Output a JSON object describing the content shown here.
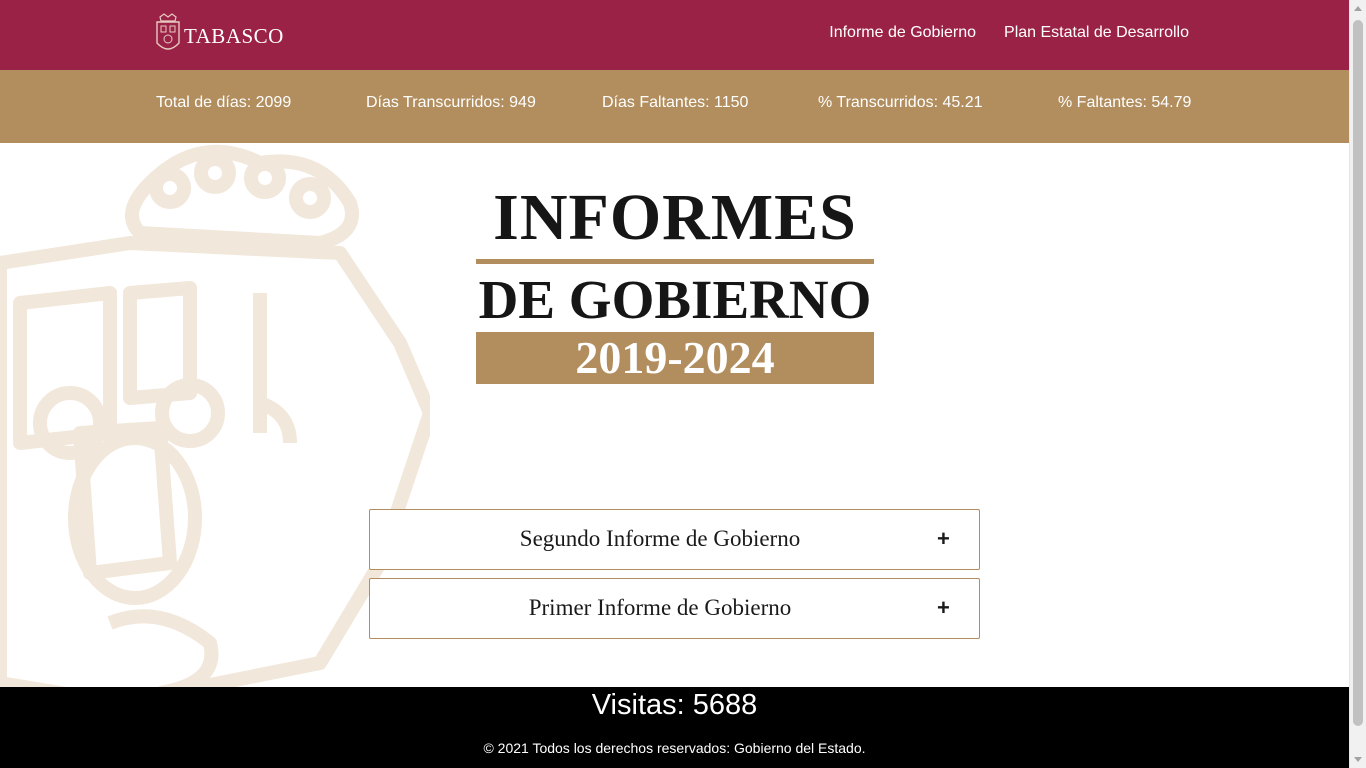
{
  "header": {
    "brand_label": "TABASCO",
    "nav": [
      "Informe de Gobierno",
      "Plan Estatal de Desarrollo"
    ]
  },
  "stats": {
    "total_dias": "Total de días: 2099",
    "dias_transcurridos": "Días Transcurridos: 949",
    "dias_faltantes": "Días Faltantes: 1150",
    "pct_transcurridos": "% Transcurridos: 45.21",
    "pct_faltantes": "% Faltantes: 54.79"
  },
  "logo": {
    "line1": "INFORMES",
    "line2": "DE GOBIERNO",
    "years": "2019-2024"
  },
  "accordion": [
    {
      "label": "Segundo Informe de Gobierno",
      "icon": "+"
    },
    {
      "label": "Primer Informe de Gobierno",
      "icon": "+"
    }
  ],
  "footer": {
    "visits": "Visitas: 5688",
    "copyright": "© 2021 Todos los derechos reservados: Gobierno del Estado."
  },
  "colors": {
    "brand": "#9b2247",
    "gold": "#b28e5e",
    "footer": "#000000"
  }
}
